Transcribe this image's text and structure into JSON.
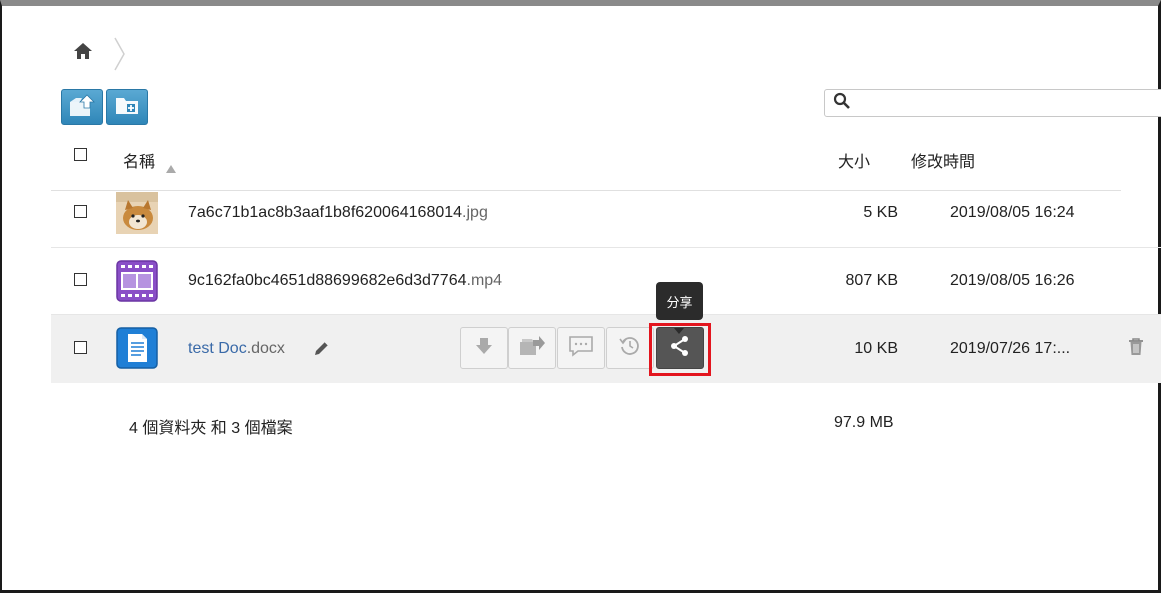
{
  "breadcrumb": {
    "home_icon": "home-icon"
  },
  "toolbar": {
    "upload_icon": "upload-icon",
    "new_folder_icon": "new-folder-icon"
  },
  "search": {
    "placeholder": ""
  },
  "table": {
    "headers": {
      "name": "名稱",
      "size": "大小",
      "modified": "修改時間"
    },
    "rows": [
      {
        "base": "7a6c71b1ac8b3aaf1b8f620064168014",
        "ext": ".jpg",
        "size": "5 KB",
        "modified": "2019/08/05 16:24",
        "thumb": "image-thumbnail"
      },
      {
        "base": "9c162fa0bc4651d88699682e6d3d7764",
        "ext": ".mp4",
        "size": "807 KB",
        "modified": "2019/08/05 16:26",
        "thumb": "video-icon"
      },
      {
        "base": "test Doc",
        "ext": ".docx",
        "size": "10 KB",
        "modified": "2019/07/26 17:...",
        "thumb": "document-icon"
      }
    ]
  },
  "tooltip": {
    "share": "分享"
  },
  "summary": {
    "counts": "4 個資料夾 和 3 個檔案",
    "total": "97.9 MB"
  },
  "colors": {
    "toolbar_blue": "#2f86b8",
    "highlight": "#e3151e",
    "link": "#3a6aa8"
  }
}
